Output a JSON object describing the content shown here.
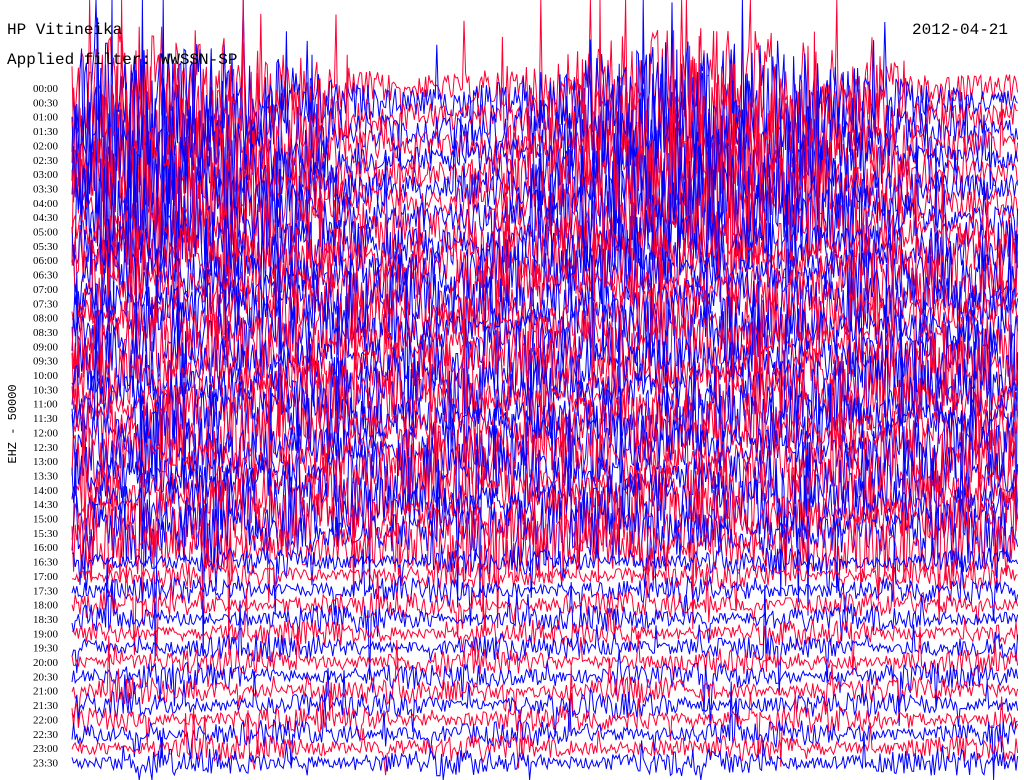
{
  "header": {
    "station": "HP Vitineika",
    "filter": "Applied filter: WWSSN-SP",
    "date": "2012-04-21"
  },
  "chart_data": {
    "type": "line",
    "title": "HP Vitineika",
    "subtitle": "Applied filter: WWSSN-SP",
    "date": "2012-04-21",
    "ylabel": "EHZ - 50000",
    "xlabel": "",
    "tick_labels": [
      "00:00",
      "00:30",
      "01:00",
      "01:30",
      "02:00",
      "02:30",
      "03:00",
      "03:30",
      "04:00",
      "04:30",
      "05:00",
      "05:30",
      "06:00",
      "06:30",
      "07:00",
      "07:30",
      "08:00",
      "08:30",
      "09:00",
      "09:30",
      "10:00",
      "10:30",
      "11:00",
      "11:30",
      "12:00",
      "12:30",
      "13:00",
      "13:30",
      "14:00",
      "14:30",
      "15:00",
      "15:30",
      "16:00",
      "16:30",
      "17:00",
      "17:30",
      "18:00",
      "18:30",
      "19:00",
      "19:30",
      "20:00",
      "20:30",
      "21:00",
      "21:30",
      "22:00",
      "22:30",
      "23:00",
      "23:30"
    ],
    "series": [
      {
        "color": "#ff0033"
      },
      {
        "color": "#0000ff"
      }
    ],
    "grid": false,
    "legend": "none"
  }
}
